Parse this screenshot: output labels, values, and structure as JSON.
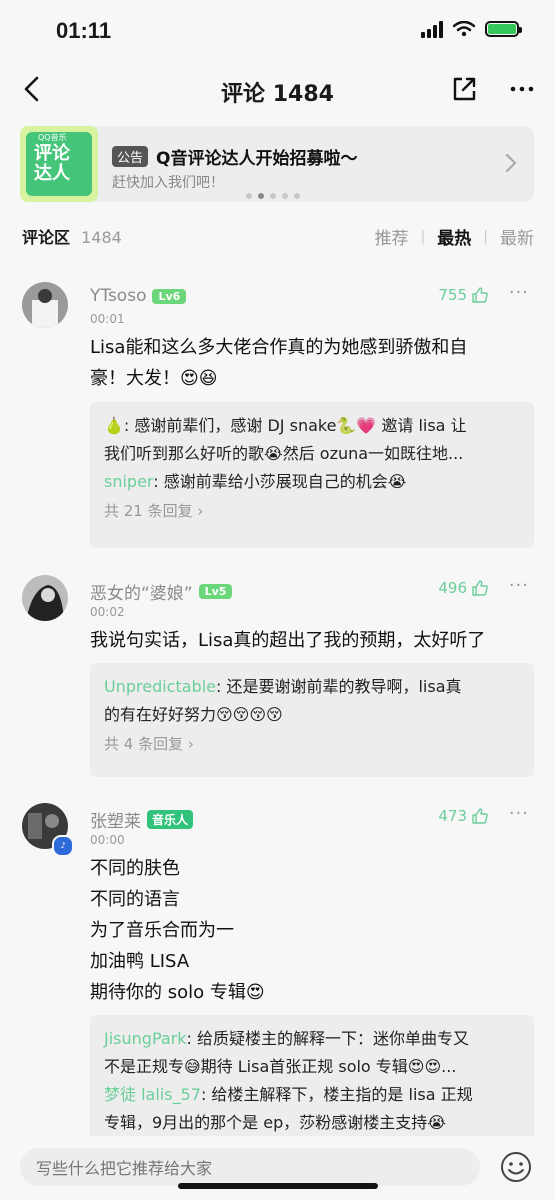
{
  "status": {
    "time": "01:11"
  },
  "header": {
    "title": "评论 1484"
  },
  "banner": {
    "image_text": "评论\n达人",
    "image_tag": "QQ音乐",
    "badge": "公告",
    "title": "Q音评论达人开始招募啦～",
    "subtitle": "赶快加入我们吧！"
  },
  "section": {
    "title": "评论区",
    "count": "1484",
    "sort": [
      "推荐",
      "最热",
      "最新"
    ],
    "sort_active": "最热"
  },
  "comments": [
    {
      "user": "YTsoso",
      "level": "Lv6",
      "time": "00:01",
      "likes": "755",
      "lines": [
        "Lisa能和这么多大佬合作真的为她感到骄傲和自",
        "豪！大发！😍😆"
      ],
      "replies": [
        {
          "name": "🍐",
          "text": ": 感谢前辈们，感谢 DJ snake🐍💗 邀请 lisa 让"
        },
        {
          "name": "",
          "text": "我们听到那么好听的歌😭然后 ozuna一如既往地..."
        },
        {
          "name": "sniper",
          "text": ": 感谢前辈给小莎展现自己的机会😭"
        }
      ],
      "reply_count": "共 21 条回复"
    },
    {
      "user": "恶女的“婆娘”",
      "level": "Lv5",
      "time": "00:02",
      "likes": "496",
      "lines": [
        "我说句实话，Lisa真的超出了我的预期，太好听了"
      ],
      "replies": [
        {
          "name": "Unpredictable",
          "text": ": 还是要谢谢前辈的教导啊，lisa真"
        },
        {
          "name": "",
          "text": "的有在好好努力😚😚😚😚"
        }
      ],
      "reply_count": "共 4 条回复"
    },
    {
      "user": "张塑莱",
      "badge": "音乐人",
      "time": "00:00",
      "likes": "473",
      "lines": [
        "不同的肤色",
        "不同的语言",
        "为了音乐合而为一",
        "加油鸭 LISA",
        "期待你的 solo 专辑😍"
      ],
      "replies": [
        {
          "name": "JisungPark",
          "text": ": 给质疑楼主的解释一下：迷你单曲专又"
        },
        {
          "name": "",
          "text": "不是正规专😅期待 Lisa首张正规 solo 专辑😍😍..."
        },
        {
          "name": "梦徒 lalis_57",
          "text": ": 给楼主解释下，楼主指的是 lisa 正规"
        },
        {
          "name": "",
          "text": "专辑，9月出的那个是 ep，莎粉感谢楼主支持😭"
        }
      ]
    }
  ],
  "input": {
    "placeholder": "写些什么把它推荐给大家"
  },
  "icons": {
    "back": "chevron-left-icon",
    "share": "share-icon",
    "more": "more-icon",
    "like": "thumbs-up-icon",
    "emoji": "emoji-icon"
  },
  "colors": {
    "accent": "#31c27c",
    "likes": "#6bcf9a"
  }
}
